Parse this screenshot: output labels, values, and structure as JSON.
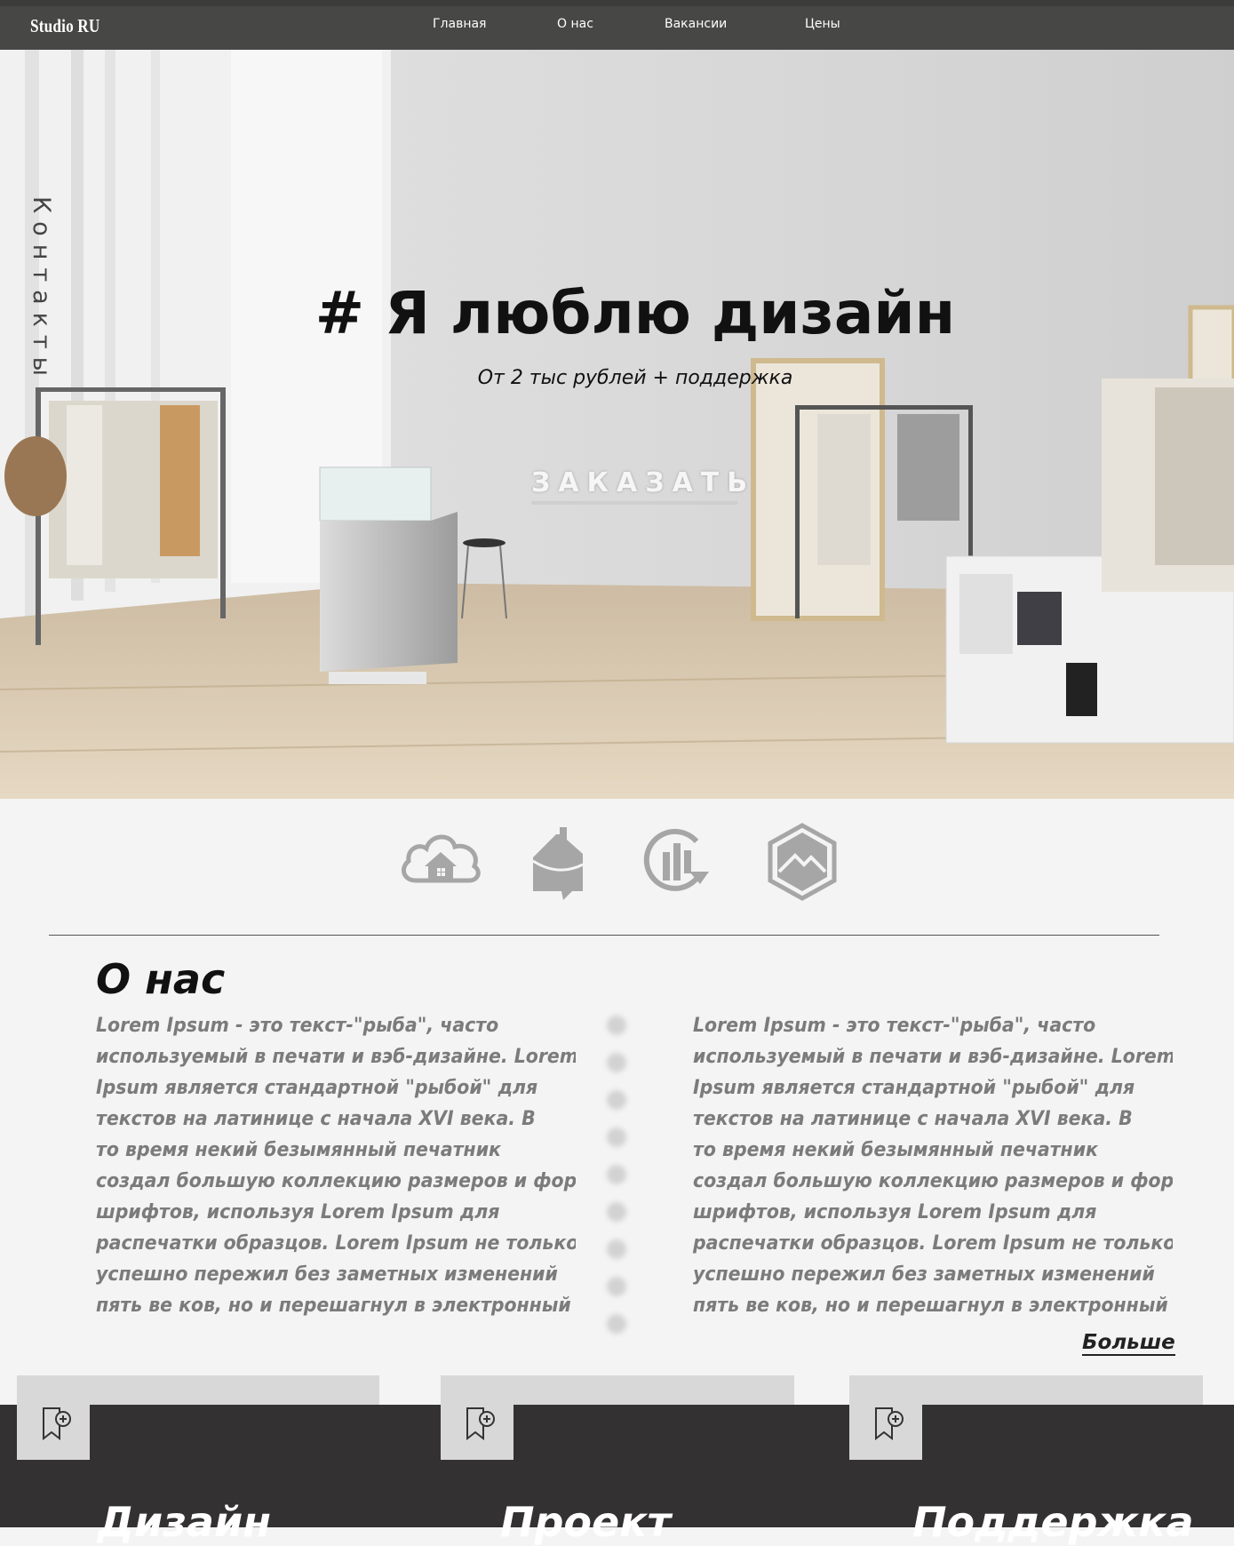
{
  "nav": {
    "logo": "Studio RU",
    "items": [
      {
        "label": "Главная"
      },
      {
        "label": "О нас"
      },
      {
        "label": "Вакансии"
      },
      {
        "label": "Цены"
      }
    ]
  },
  "hero": {
    "side_label": "Контакты",
    "title_hash": "#",
    "title": "Я люблю дизайн",
    "subtitle": "От 2 тыс рублей + поддержка",
    "cta": "ЗАКАЗАТЬ"
  },
  "features": [
    {
      "icon": "cloud-home-icon"
    },
    {
      "icon": "house-arrow-icon"
    },
    {
      "icon": "refresh-chart-icon"
    },
    {
      "icon": "hexagon-mountain-icon"
    }
  ],
  "about": {
    "title": "О нас",
    "col_left_lines": [
      "Lorem Ipsum - это текст-\"рыба\", часто",
      "используемый в печати и вэб-дизайне. Lorem",
      "Ipsum является стандартной \"рыбой\" для",
      "текстов на латинице с начала XVI века. В",
      "то время некий безымянный печатник",
      "создал большую коллекцию размеров и форм",
      "шрифтов, используя Lorem Ipsum для",
      "распечатки образцов. Lorem Ipsum не только",
      "успешно пережил без заметных изменений",
      "пять ве ков, но и перешагнул в электронный"
    ],
    "col_right_lines": [
      "Lorem Ipsum - это текст-\"рыба\", часто",
      "используемый в печати и вэб-дизайне. Lorem",
      "Ipsum является стандартной \"рыбой\" для",
      "текстов на латинице с начала XVI века. В",
      "то время некий безымянный печатник",
      "создал большую коллекцию размеров и форм",
      "шрифтов, используя Lorem Ipsum для",
      "распечатки образцов. Lorem Ipsum не только",
      "успешно пережил без заметных изменений",
      "пять ве ков, но и перешагнул в электронный"
    ],
    "more": "Больше"
  },
  "cards": [
    {
      "title": "Дизайн",
      "icon": "bookmark-add-icon"
    },
    {
      "title": "Проект",
      "icon": "bookmark-add-icon"
    },
    {
      "title": "Поддержка",
      "icon": "bookmark-add-icon"
    }
  ],
  "colors": {
    "nav_bg": "#474745",
    "dark_band": "#333131",
    "card_bg": "#d8d8d8",
    "page_bg": "#f4f4f4",
    "icon_gray": "#a6a6a6",
    "text_gray": "#7b7b7b"
  }
}
